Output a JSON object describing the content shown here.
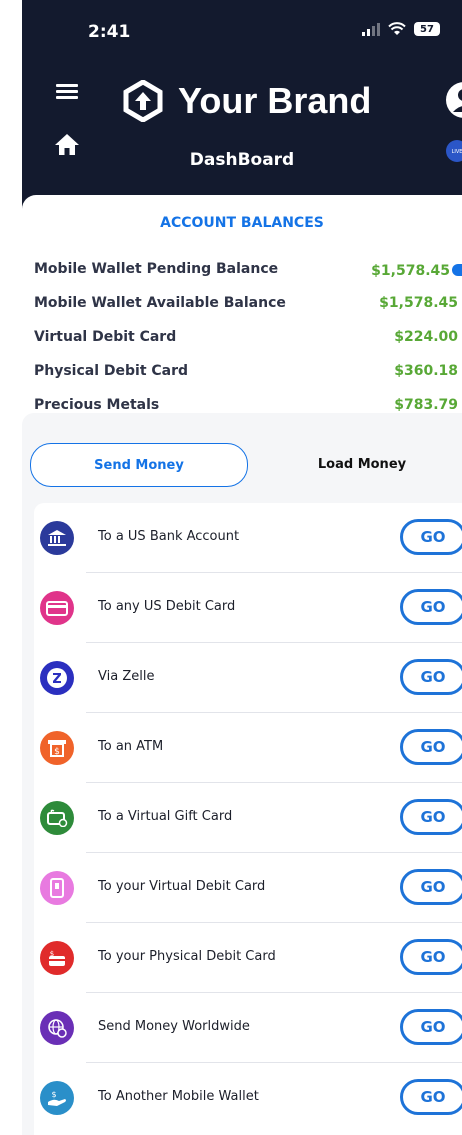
{
  "status_bar": {
    "time": "2:41",
    "battery": "57"
  },
  "header": {
    "brand": "Your Brand",
    "subtitle": "DashBoard",
    "live_chat": "LIVE CHAT"
  },
  "balances": {
    "title": "ACCOUNT BALANCES",
    "rows": [
      {
        "label": "Mobile Wallet Pending Balance",
        "value": "$1,578.45"
      },
      {
        "label": "Mobile Wallet Available Balance",
        "value": "$1,578.45"
      },
      {
        "label": "Virtual Debit Card",
        "value": "$224.00"
      },
      {
        "label": "Physical Debit Card",
        "value": "$360.18"
      },
      {
        "label": "Precious Metals",
        "value": "$783.79"
      }
    ]
  },
  "tabs": {
    "send": "Send Money",
    "load": "Load Money"
  },
  "actions": {
    "go_label": "GO",
    "items": [
      {
        "label": "To a US Bank Account",
        "icon": "bank-icon",
        "color": "#2b3a9b"
      },
      {
        "label": "To any US Debit Card",
        "icon": "debit-card-icon",
        "color": "#e0348a"
      },
      {
        "label": "Via Zelle",
        "icon": "zelle-icon",
        "color": "#2b2fbf"
      },
      {
        "label": "To an ATM",
        "icon": "atm-icon",
        "color": "#f0632a"
      },
      {
        "label": "To a Virtual Gift Card",
        "icon": "gift-card-icon",
        "color": "#2e8b3a"
      },
      {
        "label": "To your Virtual Debit Card",
        "icon": "virtual-card-icon",
        "color": "#e87ae0"
      },
      {
        "label": "To your Physical Debit Card",
        "icon": "physical-card-icon",
        "color": "#e02b2b"
      },
      {
        "label": "Send Money Worldwide",
        "icon": "globe-icon",
        "color": "#6a2fb6"
      },
      {
        "label": "To Another Mobile Wallet",
        "icon": "wallet-transfer-icon",
        "color": "#2a8fc9"
      }
    ]
  }
}
